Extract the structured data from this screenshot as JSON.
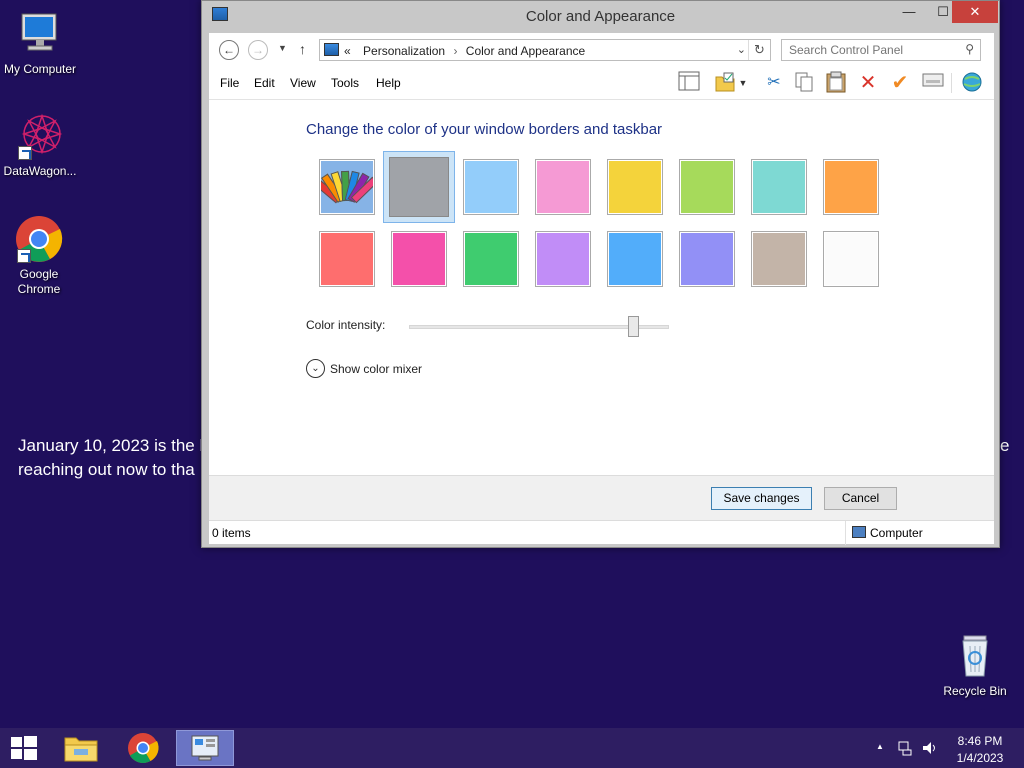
{
  "desktop": {
    "icons": [
      {
        "label": "My Computer"
      },
      {
        "label": "DataWagon..."
      },
      {
        "label": "Google Chrome"
      },
      {
        "label": "Recycle Bin"
      }
    ],
    "wallpaper_text_line1": "January 10, 2023 is the l",
    "wallpaper_text_line2": "reaching out now to tha",
    "wallpaper_text_right": "e"
  },
  "window": {
    "title": "Color and Appearance",
    "controls": {
      "minimize": "—",
      "maximize": "☐",
      "close": "✕"
    },
    "address": {
      "overflow": "«",
      "breadcrumbs": [
        "Personalization",
        "Color and Appearance"
      ]
    },
    "search": {
      "placeholder": "Search Control Panel"
    },
    "menu": [
      "File",
      "Edit",
      "View",
      "Tools",
      "Help"
    ],
    "heading": "Change the color of your window borders and taskbar",
    "swatches": {
      "row1": [
        "auto",
        "#a0a3a8",
        "#93cdfa",
        "#f59ad4",
        "#f4d33b",
        "#a6da5b",
        "#7ed9d3",
        "#fea347"
      ],
      "row2": [
        "#fe6e6e",
        "#f450aa",
        "#3fcc6f",
        "#c18df7",
        "#52adfa",
        "#9290f6",
        "#c3b4a8",
        "#fbfbfb"
      ],
      "selected_index": 1
    },
    "intensity": {
      "label": "Color intensity:",
      "value": 0.86
    },
    "mixer_label": "Show color mixer",
    "buttons": {
      "save": "Save changes",
      "cancel": "Cancel"
    },
    "status": {
      "items": "0 items",
      "location": "Computer"
    }
  },
  "taskbar": {
    "clock_time": "8:46 PM",
    "clock_date": "1/4/2023",
    "tray_arrow": "▲"
  },
  "colors": {
    "desktop_bg": "#1f0f5c",
    "taskbar_bg": "#2e1e62",
    "heading": "#1e3287",
    "close_button": "#c7413c"
  }
}
